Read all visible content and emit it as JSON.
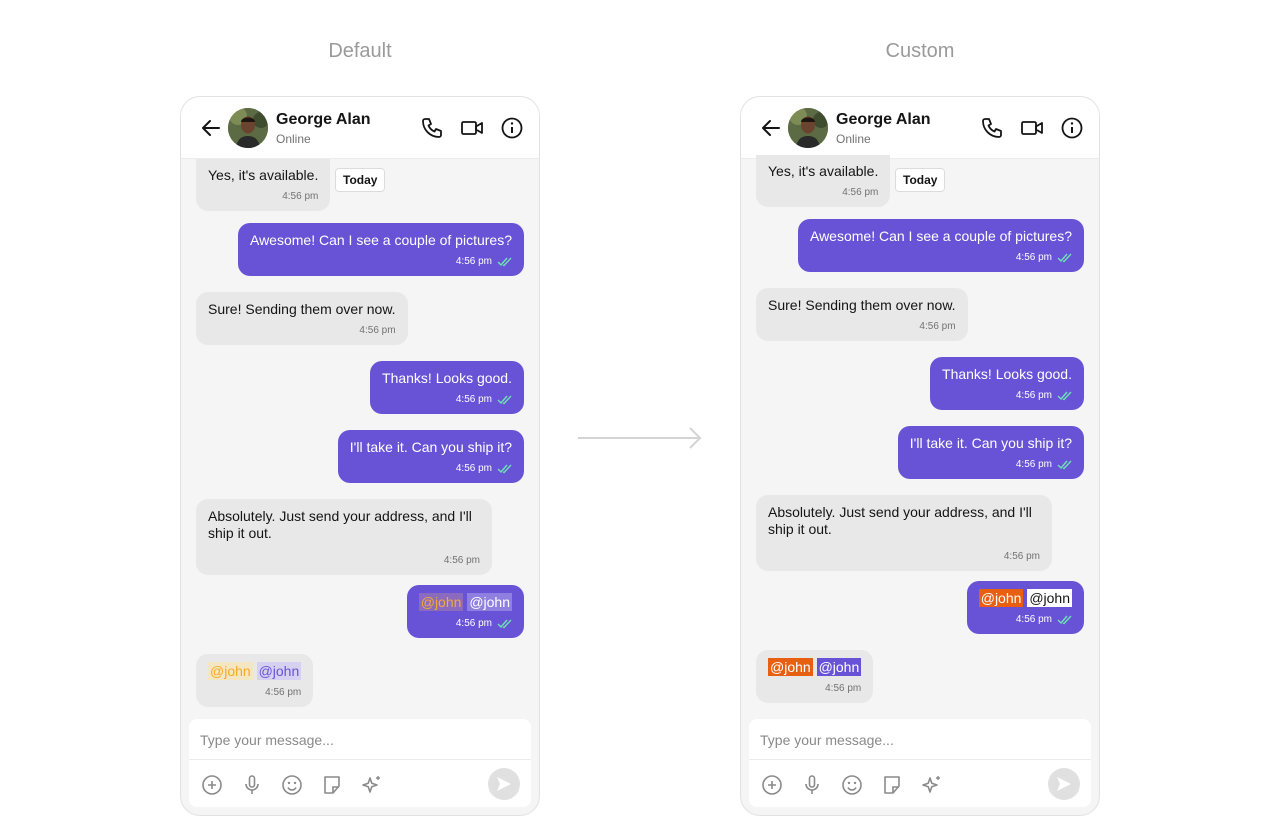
{
  "panels": [
    {
      "label": "Default",
      "header": {
        "name": "George Alan",
        "status": "Online"
      },
      "date_chip": "Today",
      "messages": [
        {
          "text": "Yes, it's available.",
          "time": "4:56 pm"
        },
        {
          "text": "Awesome! Can I see a couple of pictures?",
          "time": "4:56 pm"
        },
        {
          "text": "Sure! Sending them over now.",
          "time": "4:56 pm"
        },
        {
          "text": "Thanks! Looks good.",
          "time": "4:56 pm"
        },
        {
          "text": "I'll take it. Can you ship it?",
          "time": "4:56 pm"
        },
        {
          "text": "Absolutely. Just send your address, and I'll ship it out.",
          "time": "4:56 pm"
        },
        {
          "mention_1": "@john",
          "mention_2": "@john",
          "time": "4:56 pm"
        },
        {
          "mention_1": "@john",
          "mention_2": "@john",
          "time": "4:56 pm"
        }
      ],
      "mention_colors": {
        "outgoing_1": {
          "text": "#f6a83c",
          "bg": "#8a6bbd"
        },
        "outgoing_2": {
          "text": "#ffffff",
          "bg": "#8f7fe0"
        },
        "incoming_1": {
          "text": "#f6a823",
          "bg": "#f5e6c2"
        },
        "incoming_2": {
          "text": "#6852d6",
          "bg": "#d6d0f3"
        }
      },
      "composer": {
        "placeholder": "Type your message..."
      }
    },
    {
      "label": "Custom",
      "header": {
        "name": "George Alan",
        "status": "Online"
      },
      "date_chip": "Today",
      "messages": [
        {
          "text": "Yes, it's available.",
          "time": "4:56 pm"
        },
        {
          "text": "Awesome! Can I see a couple of pictures?",
          "time": "4:56 pm"
        },
        {
          "text": "Sure! Sending them over now.",
          "time": "4:56 pm"
        },
        {
          "text": "Thanks! Looks good.",
          "time": "4:56 pm"
        },
        {
          "text": "I'll take it. Can you ship it?",
          "time": "4:56 pm"
        },
        {
          "text": "Absolutely. Just send your address, and I'll ship it out.",
          "time": "4:56 pm"
        },
        {
          "mention_1": "@john",
          "mention_2": "@john",
          "time": "4:56 pm"
        },
        {
          "mention_1": "@john",
          "mention_2": "@john",
          "time": "4:56 pm"
        }
      ],
      "mention_colors": {
        "outgoing_1": {
          "text": "#ffffff",
          "bg": "#e85f12"
        },
        "outgoing_2": {
          "text": "#141414",
          "bg": "#ffffff"
        },
        "incoming_1": {
          "text": "#ffffff",
          "bg": "#e85f12"
        },
        "incoming_2": {
          "text": "#ffffff",
          "bg": "#6852d6"
        }
      },
      "composer": {
        "placeholder": "Type your message..."
      }
    }
  ],
  "colors": {
    "outgoing_bubble": "#6852d6",
    "incoming_bubble": "#e8e8e8",
    "read_tick": "#6fe2b3"
  },
  "icons": {
    "header": [
      "back-arrow-icon",
      "voice-call-icon",
      "video-call-icon",
      "info-icon"
    ],
    "composer": [
      "add-icon",
      "microphone-icon",
      "emoji-icon",
      "sticker-icon",
      "ai-sparkle-icon",
      "send-icon"
    ],
    "transition": "arrow-right-icon"
  }
}
